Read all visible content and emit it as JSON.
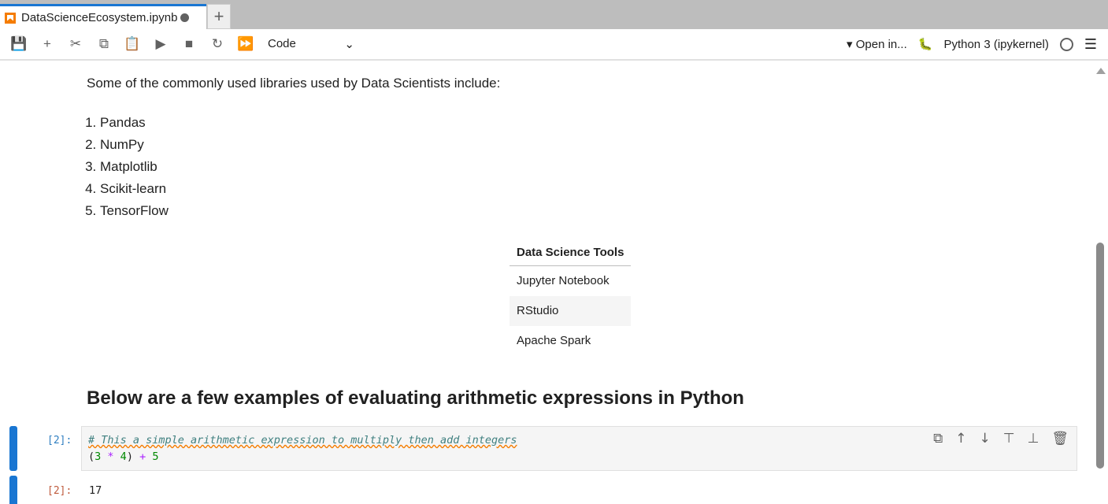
{
  "tab": {
    "title": "DataScienceEcosystem.ipynb",
    "add": "+"
  },
  "toolbar": {
    "cell_type": "Code",
    "open_in": "Open in...",
    "kernel": "Python 3 (ipykernel)"
  },
  "markdown": {
    "intro": "Some of the commonly used libraries used by Data Scientists include:",
    "libraries": [
      "Pandas",
      "NumPy",
      "Matplotlib",
      "Scikit-learn",
      "TensorFlow"
    ],
    "table": {
      "header": "Data Science Tools",
      "rows": [
        "Jupyter Notebook",
        "RStudio",
        "Apache Spark"
      ]
    },
    "heading": "Below are a few examples of evaluating arithmetic expressions in Python"
  },
  "code_cell": {
    "prompt": "[2]:",
    "comment": "# This a simple arithmetic expression to multiply then add integers",
    "code": {
      "p1": "(",
      "a": "3",
      "op1": " * ",
      "b": "4",
      "p2": ")",
      "op2": " + ",
      "c": "5"
    }
  },
  "output": {
    "prompt": "[2]:",
    "value": "17"
  }
}
